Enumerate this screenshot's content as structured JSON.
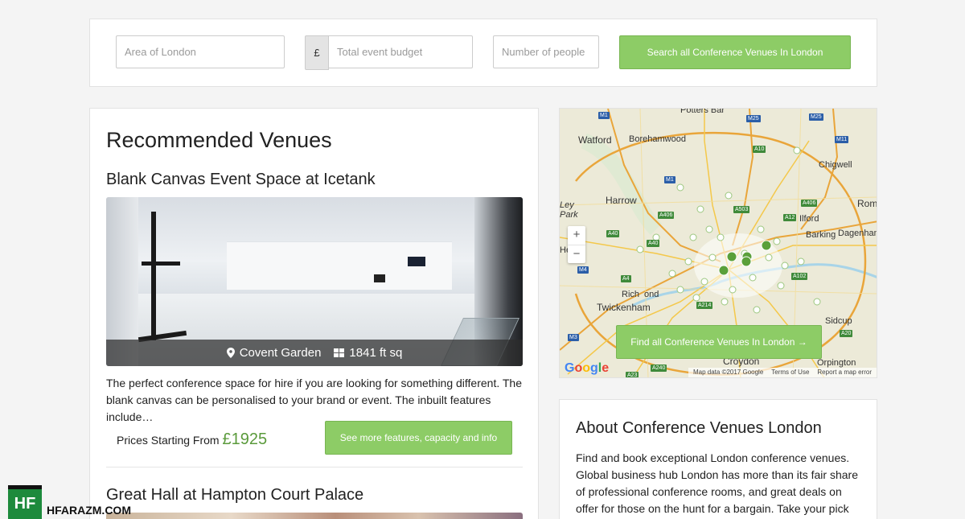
{
  "search": {
    "area_placeholder": "Area of London",
    "currency_symbol": "£",
    "budget_placeholder": "Total event budget",
    "people_placeholder": "Number of people",
    "search_button": "Search all Conference Venues In London"
  },
  "recommended": {
    "title": "Recommended Venues",
    "venues": [
      {
        "name": "Blank Canvas Event Space at Icetank",
        "location": "Covent Garden",
        "size": "1841 ft sq",
        "description": "The perfect conference space for hire if you are looking for something different. The blank canvas can be personalised to your brand or event. The inbuilt features include…",
        "price_label": "Prices Starting From",
        "price": "£1925",
        "more_button": "See more features, capacity and info"
      },
      {
        "name": "Great Hall at Hampton Court Palace"
      }
    ]
  },
  "map": {
    "labels": [
      "Potters Bar",
      "Watford",
      "Borehamwood",
      "Chigwell",
      "Harrow",
      "Rom",
      "Ilford",
      "Barking",
      "Dagenham",
      "Rich",
      "ond",
      "Twickenham",
      "Sidcup",
      "Croydon",
      "Orpington",
      "Ley",
      "Park",
      "He"
    ],
    "roads_m": [
      "M1",
      "M25",
      "M25",
      "M11",
      "M1",
      "M4",
      "M3"
    ],
    "roads_a": [
      "A10",
      "A503",
      "A406",
      "A12",
      "A406",
      "A40",
      "A40",
      "A4",
      "A102",
      "A214",
      "A20",
      "A240",
      "A23"
    ],
    "zoom_in": "+",
    "zoom_out": "−",
    "find_button": "Find all Conference Venues In London →",
    "google": [
      "G",
      "o",
      "o",
      "g",
      "l",
      "e"
    ],
    "footer": [
      "Map data ©2017 Google",
      "Terms of Use",
      "Report a map error"
    ],
    "colors": {
      "land": "#efe9d9",
      "major_road": "#f4c84a",
      "motorway": "#e9a53a",
      "water": "#a8d4e8",
      "pin": "#7cbf4c"
    }
  },
  "about": {
    "title": "About Conference Venues London",
    "text": "Find and book exceptional London conference venues. Global business hub London has more than its fair share of professional conference rooms, and great deals on offer for those on the hunt for a bargain. Take your pick from the"
  },
  "watermark": {
    "logo": "HF",
    "site": "HFARAZM.COM"
  },
  "colors": {
    "accent": "#8dcc66",
    "price": "#5a9a3b"
  }
}
